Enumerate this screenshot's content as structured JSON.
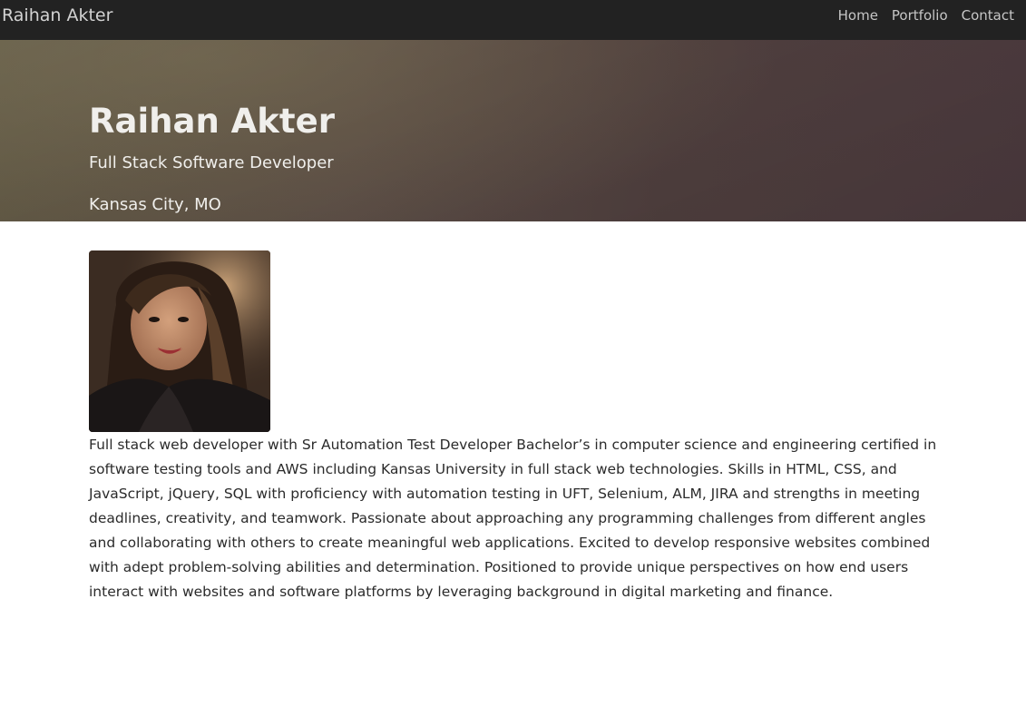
{
  "nav": {
    "brand": "Raihan Akter",
    "links": [
      "Home",
      "Portfolio",
      "Contact"
    ]
  },
  "hero": {
    "name": "Raihan Akter",
    "title": "Full Stack Software Developer",
    "location": "Kansas City, MO"
  },
  "about": {
    "bio": "Full stack web developer with Sr Automation Test Developer Bachelor’s in computer science and engineering certified in software testing tools and AWS including Kansas University in full stack web technologies. Skills in HTML, CSS, and JavaScript, jQuery, SQL with proficiency with automation testing in UFT, Selenium, ALM, JIRA and strengths in meeting deadlines, creativity, and teamwork. Passionate about approaching any programming challenges from different angles and collaborating with others to create meaningful web applications. Excited to develop responsive websites combined with adept problem-solving abilities and determination. Positioned to provide unique perspectives on how end users interact with websites and software platforms by leveraging background in digital marketing and finance."
  },
  "colors": {
    "navbar": "#222222",
    "hero_left": "#5d5541",
    "hero_right": "#4d3b3f"
  }
}
